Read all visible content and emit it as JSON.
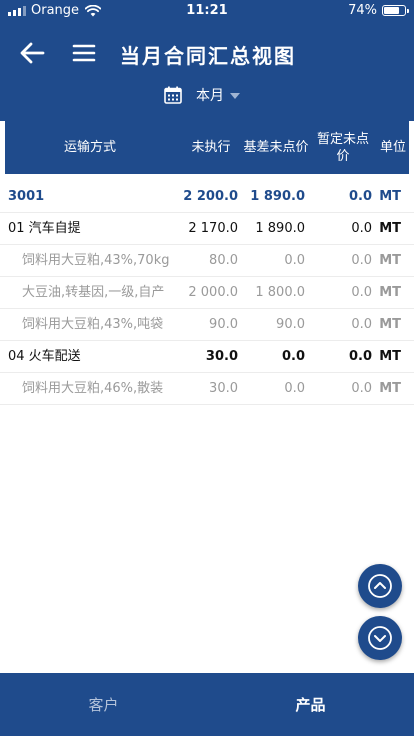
{
  "status_bar": {
    "carrier": "Orange",
    "time": "11:21",
    "battery": "74%",
    "battery_level": 0.74
  },
  "header": {
    "title": "当月合同汇总视图",
    "period": "本月"
  },
  "table": {
    "headers": {
      "mode": "运输方式",
      "executed": "未执行",
      "basis": "基差未点价",
      "tentative": "暂定未点价",
      "unit": "单位"
    },
    "rows": [
      {
        "name": "3001",
        "executed": "2 200.0",
        "basis": "1 890.0",
        "tentative": "0.0",
        "unit": "MT"
      },
      {
        "name": "01 汽车自提",
        "executed": "2 170.0",
        "basis": "1 890.0",
        "tentative": "0.0",
        "unit": "MT"
      },
      {
        "name": "饲料用大豆粕,43%,70kg",
        "executed": "80.0",
        "basis": "0.0",
        "tentative": "0.0",
        "unit": "MT"
      },
      {
        "name": "大豆油,转基因,一级,自产",
        "executed": "2 000.0",
        "basis": "1 800.0",
        "tentative": "0.0",
        "unit": "MT"
      },
      {
        "name": "饲料用大豆粕,43%,吨袋",
        "executed": "90.0",
        "basis": "90.0",
        "tentative": "0.0",
        "unit": "MT"
      },
      {
        "name": "04 火车配送",
        "executed": "30.0",
        "basis": "0.0",
        "tentative": "0.0",
        "unit": "MT"
      },
      {
        "name": "饲料用大豆粕,46%,散装",
        "executed": "30.0",
        "basis": "0.0",
        "tentative": "0.0",
        "unit": "MT"
      }
    ]
  },
  "tabs": {
    "customer": "客户",
    "product": "产品"
  },
  "icons": {
    "back": "arrow-left-icon",
    "menu": "hamburger-menu-icon",
    "calendar": "calendar-icon",
    "dropdown": "caret-down-icon",
    "scroll_up": "chevron-up-circle-icon",
    "scroll_down": "chevron-down-circle-icon"
  },
  "colors": {
    "primary": "#1f4b8c",
    "muted_text": "#9a9a9a",
    "inactive_tab": "#b4c3da"
  }
}
